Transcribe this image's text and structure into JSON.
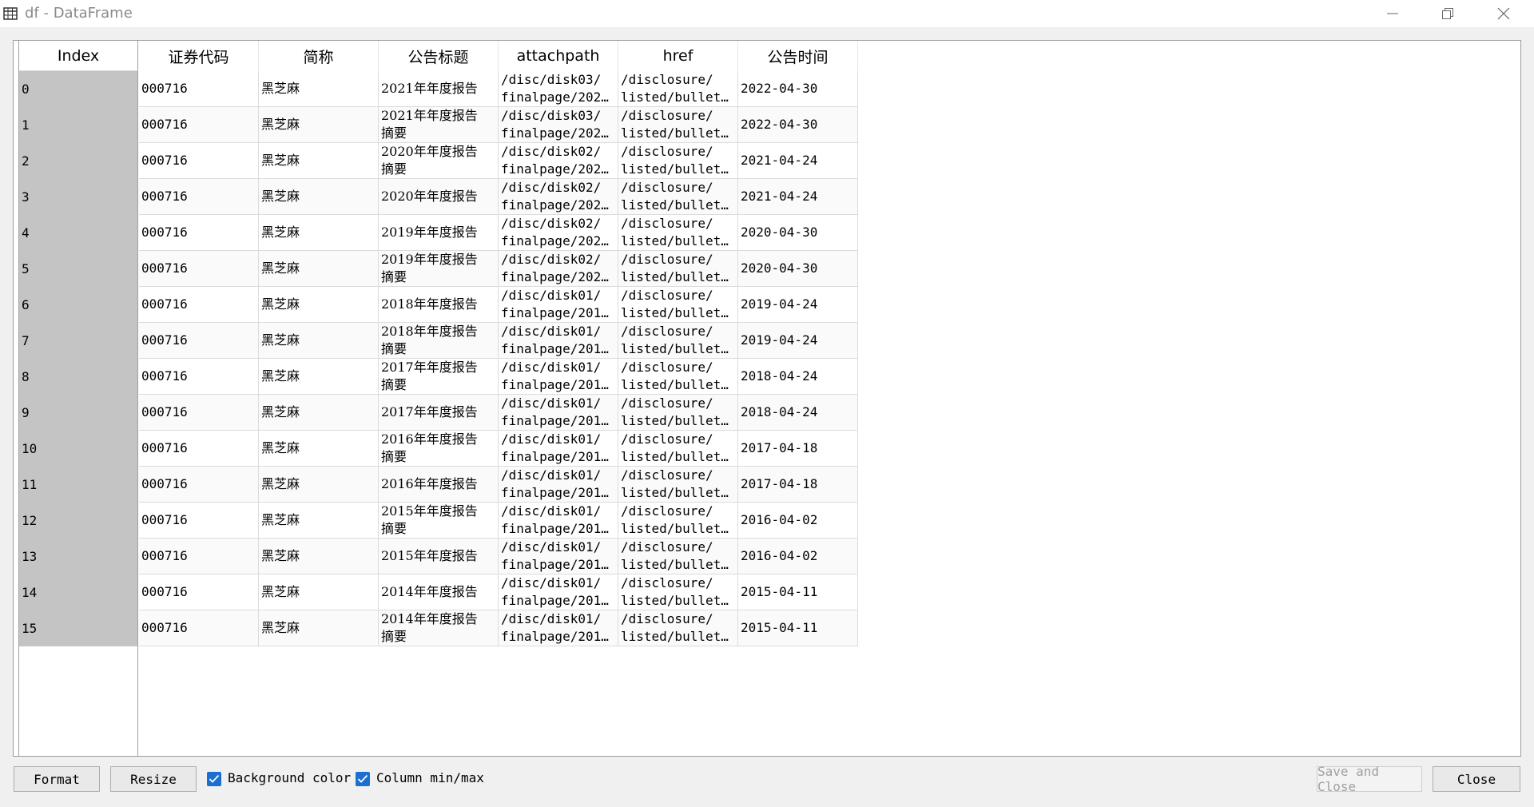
{
  "window": {
    "title": "df - DataFrame"
  },
  "table": {
    "index_header": "Index",
    "columns": [
      "证券代码",
      "简称",
      "公告标题",
      "attachpath",
      "href",
      "公告时间"
    ],
    "rows": [
      {
        "index": "0",
        "code": "000716",
        "name": "黑芝麻",
        "title": [
          "2021年年度报告",
          ""
        ],
        "attach": [
          "/disc/disk03/",
          "finalpage/202…"
        ],
        "href": [
          "/disclosure/",
          "listed/bullet…"
        ],
        "date": "2022-04-30"
      },
      {
        "index": "1",
        "code": "000716",
        "name": "黑芝麻",
        "title": [
          "2021年年度报告",
          "摘要"
        ],
        "attach": [
          "/disc/disk03/",
          "finalpage/202…"
        ],
        "href": [
          "/disclosure/",
          "listed/bullet…"
        ],
        "date": "2022-04-30"
      },
      {
        "index": "2",
        "code": "000716",
        "name": "黑芝麻",
        "title": [
          "2020年年度报告",
          "摘要"
        ],
        "attach": [
          "/disc/disk02/",
          "finalpage/202…"
        ],
        "href": [
          "/disclosure/",
          "listed/bullet…"
        ],
        "date": "2021-04-24"
      },
      {
        "index": "3",
        "code": "000716",
        "name": "黑芝麻",
        "title": [
          "2020年年度报告",
          ""
        ],
        "attach": [
          "/disc/disk02/",
          "finalpage/202…"
        ],
        "href": [
          "/disclosure/",
          "listed/bullet…"
        ],
        "date": "2021-04-24"
      },
      {
        "index": "4",
        "code": "000716",
        "name": "黑芝麻",
        "title": [
          "2019年年度报告",
          ""
        ],
        "attach": [
          "/disc/disk02/",
          "finalpage/202…"
        ],
        "href": [
          "/disclosure/",
          "listed/bullet…"
        ],
        "date": "2020-04-30"
      },
      {
        "index": "5",
        "code": "000716",
        "name": "黑芝麻",
        "title": [
          "2019年年度报告",
          "摘要"
        ],
        "attach": [
          "/disc/disk02/",
          "finalpage/202…"
        ],
        "href": [
          "/disclosure/",
          "listed/bullet…"
        ],
        "date": "2020-04-30"
      },
      {
        "index": "6",
        "code": "000716",
        "name": "黑芝麻",
        "title": [
          "2018年年度报告",
          ""
        ],
        "attach": [
          "/disc/disk01/",
          "finalpage/201…"
        ],
        "href": [
          "/disclosure/",
          "listed/bullet…"
        ],
        "date": "2019-04-24"
      },
      {
        "index": "7",
        "code": "000716",
        "name": "黑芝麻",
        "title": [
          "2018年年度报告",
          "摘要"
        ],
        "attach": [
          "/disc/disk01/",
          "finalpage/201…"
        ],
        "href": [
          "/disclosure/",
          "listed/bullet…"
        ],
        "date": "2019-04-24"
      },
      {
        "index": "8",
        "code": "000716",
        "name": "黑芝麻",
        "title": [
          "2017年年度报告",
          "摘要"
        ],
        "attach": [
          "/disc/disk01/",
          "finalpage/201…"
        ],
        "href": [
          "/disclosure/",
          "listed/bullet…"
        ],
        "date": "2018-04-24"
      },
      {
        "index": "9",
        "code": "000716",
        "name": "黑芝麻",
        "title": [
          "2017年年度报告",
          ""
        ],
        "attach": [
          "/disc/disk01/",
          "finalpage/201…"
        ],
        "href": [
          "/disclosure/",
          "listed/bullet…"
        ],
        "date": "2018-04-24"
      },
      {
        "index": "10",
        "code": "000716",
        "name": "黑芝麻",
        "title": [
          "2016年年度报告",
          "摘要"
        ],
        "attach": [
          "/disc/disk01/",
          "finalpage/201…"
        ],
        "href": [
          "/disclosure/",
          "listed/bullet…"
        ],
        "date": "2017-04-18"
      },
      {
        "index": "11",
        "code": "000716",
        "name": "黑芝麻",
        "title": [
          "2016年年度报告",
          ""
        ],
        "attach": [
          "/disc/disk01/",
          "finalpage/201…"
        ],
        "href": [
          "/disclosure/",
          "listed/bullet…"
        ],
        "date": "2017-04-18"
      },
      {
        "index": "12",
        "code": "000716",
        "name": "黑芝麻",
        "title": [
          "2015年年度报告",
          "摘要"
        ],
        "attach": [
          "/disc/disk01/",
          "finalpage/201…"
        ],
        "href": [
          "/disclosure/",
          "listed/bullet…"
        ],
        "date": "2016-04-02"
      },
      {
        "index": "13",
        "code": "000716",
        "name": "黑芝麻",
        "title": [
          "2015年年度报告",
          ""
        ],
        "attach": [
          "/disc/disk01/",
          "finalpage/201…"
        ],
        "href": [
          "/disclosure/",
          "listed/bullet…"
        ],
        "date": "2016-04-02"
      },
      {
        "index": "14",
        "code": "000716",
        "name": "黑芝麻",
        "title": [
          "2014年年度报告",
          ""
        ],
        "attach": [
          "/disc/disk01/",
          "finalpage/201…"
        ],
        "href": [
          "/disclosure/",
          "listed/bullet…"
        ],
        "date": "2015-04-11"
      },
      {
        "index": "15",
        "code": "000716",
        "name": "黑芝麻",
        "title": [
          "2014年年度报告",
          "摘要"
        ],
        "attach": [
          "/disc/disk01/",
          "finalpage/201…"
        ],
        "href": [
          "/disclosure/",
          "listed/bullet…"
        ],
        "date": "2015-04-11"
      }
    ]
  },
  "bottom": {
    "format_label": "Format",
    "resize_label": "Resize",
    "bg_color_label": "Background color",
    "bg_color_checked": true,
    "minmax_label": "Column min/max",
    "minmax_checked": true,
    "save_close_label": "Save and Close",
    "close_label": "Close"
  },
  "colors": {
    "index_bg": "#c4c4c4",
    "checkbox": "#1a6fd0"
  }
}
